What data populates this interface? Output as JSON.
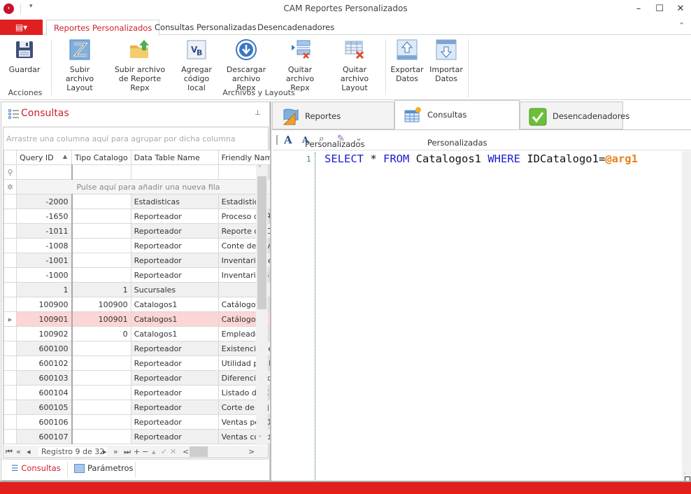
{
  "window": {
    "title": "CAM Reportes Personalizados",
    "minimize_label": "–",
    "maximize_label": "☐",
    "close_label": "✕"
  },
  "ribbon": {
    "file_menu_label": "▤▾",
    "tabs": [
      {
        "label": "Reportes Personalizados",
        "active": true
      },
      {
        "label": "Consultas Personalizadas",
        "active": false
      },
      {
        "label": "Desencadenadores",
        "active": false
      }
    ],
    "collapse_label": "⌃",
    "groups": [
      {
        "label": "Acciones",
        "buttons": [
          {
            "label1": "Guardar",
            "label2": "",
            "icon": "save-icon"
          }
        ]
      },
      {
        "label": "Archivos y Layouts",
        "buttons": [
          {
            "label1": "Subir archivo",
            "label2": "Layout",
            "icon": "upload-layout-icon"
          },
          {
            "label1": "Subir archivo",
            "label2": "de Reporte Repx",
            "icon": "upload-folder-icon"
          },
          {
            "label1": "Agregar",
            "label2": "código local",
            "icon": "vb-code-icon"
          },
          {
            "label1": "Descargar",
            "label2": "archivo Repx",
            "icon": "download-icon"
          },
          {
            "label1": "Quitar",
            "label2": "archivo Repx",
            "icon": "remove-repx-icon"
          },
          {
            "label1": "Quitar archivo",
            "label2": "Layout",
            "icon": "remove-layout-icon"
          },
          {
            "label1": "Exportar",
            "label2": "Datos",
            "icon": "export-icon"
          },
          {
            "label1": "Importar",
            "label2": "Datos",
            "icon": "import-icon"
          }
        ]
      }
    ]
  },
  "left_panel": {
    "title": "Consultas",
    "pin_label": "⊥",
    "group_hint": "Arrastre una columna aquí para agrupar por dicha columna",
    "columns": [
      "Query ID",
      "Tipo Catalogo",
      "Data Table Name",
      "Friendly Name"
    ],
    "sort_indicator": "▲",
    "new_row_hint": "Pulse aquí para añadir una nueva fila",
    "rows": [
      {
        "query_id": "-2000",
        "tipo": "",
        "table": "Estadisticas",
        "friendly": "Estadisticas"
      },
      {
        "query_id": "-1650",
        "tipo": "",
        "table": "Reporteador",
        "friendly": "Proceso de R"
      },
      {
        "query_id": "-1011",
        "tipo": "",
        "table": "Reporteador",
        "friendly": "Reporte de D"
      },
      {
        "query_id": "-1008",
        "tipo": "",
        "table": "Reporteador",
        "friendly": "Conte de inv"
      },
      {
        "query_id": "-1001",
        "tipo": "",
        "table": "Reporteador",
        "friendly": "Inventario de"
      },
      {
        "query_id": "-1000",
        "tipo": "",
        "table": "Reporteador",
        "friendly": "Inventario G"
      },
      {
        "query_id": "1",
        "tipo": "1",
        "table": "Sucursales",
        "friendly": ""
      },
      {
        "query_id": "100900",
        "tipo": "100900",
        "table": "Catalogos1",
        "friendly": "Catálogo de"
      },
      {
        "query_id": "100901",
        "tipo": "100901",
        "table": "Catalogos1",
        "friendly": "Catálogo de",
        "selected": true
      },
      {
        "query_id": "100902",
        "tipo": "0",
        "table": "Catalogos1",
        "friendly": "Empleados"
      },
      {
        "query_id": "600100",
        "tipo": "",
        "table": "Reporteador",
        "friendly": "Existencia de"
      },
      {
        "query_id": "600102",
        "tipo": "",
        "table": "Reporteador",
        "friendly": "Utilidad por F"
      },
      {
        "query_id": "600103",
        "tipo": "",
        "table": "Reporteador",
        "friendly": "Diferencias d"
      },
      {
        "query_id": "600104",
        "tipo": "",
        "table": "Reporteador",
        "friendly": "Listado de C"
      },
      {
        "query_id": "600105",
        "tipo": "",
        "table": "Reporteador",
        "friendly": "Corte de Caj"
      },
      {
        "query_id": "600106",
        "tipo": "",
        "table": "Reporteador",
        "friendly": "Ventas por D"
      },
      {
        "query_id": "600107",
        "tipo": "",
        "table": "Reporteador",
        "friendly": "Ventas con d"
      }
    ],
    "navigator": {
      "first": "⏮",
      "prev_page": "«",
      "prev": "◂",
      "record_text": "Registro 9 de 32",
      "next": "▸",
      "next_page": "»",
      "last": "⏭",
      "add": "+",
      "delete": "−",
      "edit": "▴",
      "save": "✓",
      "cancel": "✕",
      "scroll_left": "<",
      "scroll_right": ">"
    },
    "bottom_tabs": [
      {
        "label": "Consultas",
        "active": true
      },
      {
        "label": "Parámetros",
        "active": false
      }
    ]
  },
  "right_panel": {
    "tabs": [
      {
        "label": "Reportes Personalizados",
        "active": false
      },
      {
        "label": "Consultas Personalizadas",
        "active": true
      },
      {
        "label": "Desencadenadores",
        "active": false
      }
    ],
    "toolbar": {
      "increase_font": "A",
      "decrease_font": "A",
      "find": "⌕",
      "format": "✎",
      "more": "⌄"
    },
    "editor": {
      "line_number": "1",
      "tokens": [
        {
          "t": "SELECT",
          "c": "kw"
        },
        {
          "t": " * ",
          "c": ""
        },
        {
          "t": "FROM",
          "c": "kw"
        },
        {
          "t": " Catalogos1 ",
          "c": ""
        },
        {
          "t": "WHERE",
          "c": "kw"
        },
        {
          "t": " IDCatalogo1=",
          "c": ""
        },
        {
          "t": "@arg1",
          "c": "param"
        }
      ]
    }
  },
  "colors": {
    "accent": "#e02020",
    "selected_row": "#fcd6d6",
    "keyword": "#1a1ad0",
    "parameter": "#e8821a"
  }
}
